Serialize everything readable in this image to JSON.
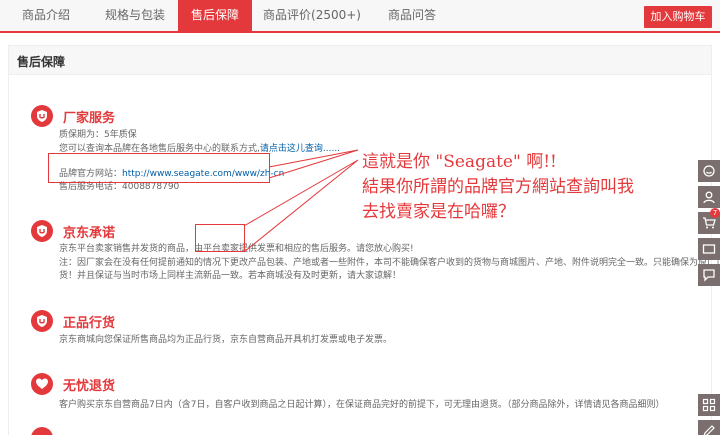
{
  "tabs": [
    {
      "label": "商品介绍"
    },
    {
      "label": "规格与包装"
    },
    {
      "label": "售后保障"
    },
    {
      "label": "商品评价(2500+)"
    },
    {
      "label": "商品问答"
    }
  ],
  "buy_button": "加入购物车",
  "section_title": "售后保障",
  "blocks": {
    "factory": {
      "title": "厂家服务",
      "warranty": "质保期为：5年质保",
      "query_text": "您可以查询本品牌在各地售后服务中心的联系方式,",
      "query_link": "请点击这儿查询......",
      "site_label": "品牌官方网站：",
      "site_url": "http://www.seagate.com/www/zh-cn",
      "phone_label": "售后服务电话：",
      "phone": "4008878790"
    },
    "jd_promise": {
      "title": "京东承诺",
      "line1_a": "京东平台卖家销售并发货的商品，",
      "line1_b": "由平台卖家",
      "line1_c": "提供发票和相应的售后服务。请您放心购买!",
      "line2": "注：因厂家会在没有任何提前通知的情况下更改产品包装、产地或者一些附件，本司不能确保客户收到的货物与商城图片、产地、附件说明完全一致。只能确保为原厂正",
      "line3": "货！并且保证与当时市场上同样主流新品一致。若本商城没有及时更新，请大家谅解！"
    },
    "genuine": {
      "title": "正品行货",
      "line1": "京东商城向您保证所售商品均为正品行货，京东自营商品开具机打发票或电子发票。"
    },
    "return": {
      "title": "无忧退货",
      "line1": "客户购买京东自营商品7日内（含7日，自客户收到商品之日起计算），在保证商品完好的前提下，可无理由退货。（部分商品除外，详情请见各商品细则）"
    }
  },
  "annotation": {
    "line1": "這就是你 \"Seagate\" 啊!!",
    "line2": "結果你所謂的品牌官方網站查詢叫我",
    "line3": "去找賣家是在哈囉？"
  },
  "sidebar": {
    "cart_count": "7"
  },
  "colors": {
    "accent": "#e4393c",
    "link": "#005ea7",
    "sidebar": "#7a6e6e"
  }
}
